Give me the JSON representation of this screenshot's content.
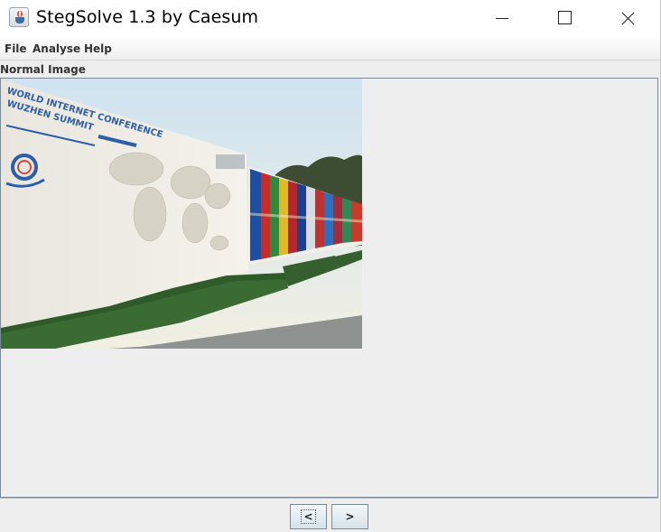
{
  "window": {
    "title": "StegSolve 1.3 by Caesum"
  },
  "menu": {
    "file": "File",
    "analyse": "Analyse",
    "help": "Help"
  },
  "panel": {
    "label": "Normal Image"
  },
  "image": {
    "sign_line1": "WORLD INTERNET CONFERENCE",
    "sign_line2": "WUZHEN SUMMIT"
  },
  "nav": {
    "prev_label": "<",
    "next_label": ">"
  },
  "icons": {
    "app": "java-coffee-cup-icon",
    "minimize": "minimize-icon",
    "maximize": "maximize-icon",
    "close": "close-icon"
  },
  "colors": {
    "window_bg": "#eeeeee",
    "frame_border": "#7a8a99",
    "button_bg": "#d7e2ea"
  }
}
